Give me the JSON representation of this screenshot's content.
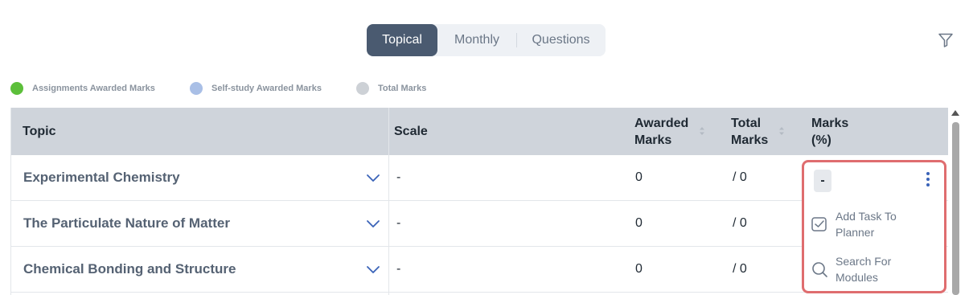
{
  "tabs": [
    {
      "label": "Topical",
      "active": true
    },
    {
      "label": "Monthly",
      "active": false
    },
    {
      "label": "Questions",
      "active": false
    }
  ],
  "legend": [
    {
      "label": "Assignments Awarded Marks",
      "color": "#5cbf3a"
    },
    {
      "label": "Self-study Awarded Marks",
      "color": "#a9bfe6"
    },
    {
      "label": "Total Marks",
      "color": "#cdd1d6"
    }
  ],
  "table": {
    "headers": {
      "topic": "Topic",
      "scale": "Scale",
      "awarded_line1": "Awarded",
      "awarded_line2": "Marks",
      "total_line1": "Total",
      "total_line2": "Marks",
      "marks_line1": "Marks",
      "marks_line2": "(%)"
    },
    "rows": [
      {
        "topic": "Experimental Chemistry",
        "scale": "-",
        "awarded": "0",
        "total": "/ 0"
      },
      {
        "topic": "The Particulate Nature of Matter",
        "scale": "-",
        "awarded": "0",
        "total": "/ 0"
      },
      {
        "topic": "Chemical Bonding and Structure",
        "scale": "-",
        "awarded": "0",
        "total": "/ 0"
      }
    ]
  },
  "popup": {
    "marks_value": "-",
    "menu": [
      {
        "label": "Add Task To Planner",
        "icon": "planner-check-icon"
      },
      {
        "label": "Search For Modules",
        "icon": "search-icon"
      }
    ]
  },
  "colors": {
    "tab_active": "#4a5a70",
    "highlight_border": "#df6d6f",
    "chevron": "#3a63b8",
    "kebab": "#3a63b8"
  }
}
